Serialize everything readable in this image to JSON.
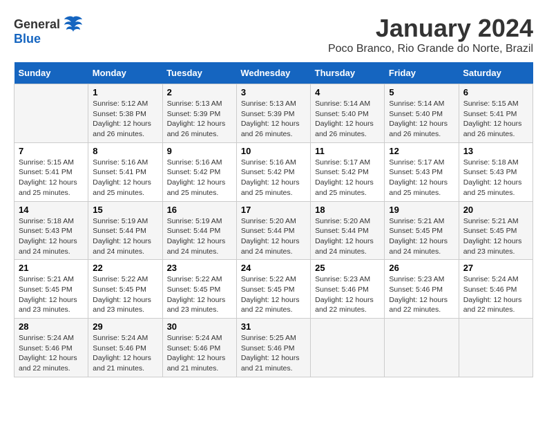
{
  "header": {
    "logo_general": "General",
    "logo_blue": "Blue",
    "month_year": "January 2024",
    "location": "Poco Branco, Rio Grande do Norte, Brazil"
  },
  "calendar": {
    "days_of_week": [
      "Sunday",
      "Monday",
      "Tuesday",
      "Wednesday",
      "Thursday",
      "Friday",
      "Saturday"
    ],
    "weeks": [
      [
        {
          "day": "",
          "info": ""
        },
        {
          "day": "1",
          "info": "Sunrise: 5:12 AM\nSunset: 5:38 PM\nDaylight: 12 hours\nand 26 minutes."
        },
        {
          "day": "2",
          "info": "Sunrise: 5:13 AM\nSunset: 5:39 PM\nDaylight: 12 hours\nand 26 minutes."
        },
        {
          "day": "3",
          "info": "Sunrise: 5:13 AM\nSunset: 5:39 PM\nDaylight: 12 hours\nand 26 minutes."
        },
        {
          "day": "4",
          "info": "Sunrise: 5:14 AM\nSunset: 5:40 PM\nDaylight: 12 hours\nand 26 minutes."
        },
        {
          "day": "5",
          "info": "Sunrise: 5:14 AM\nSunset: 5:40 PM\nDaylight: 12 hours\nand 26 minutes."
        },
        {
          "day": "6",
          "info": "Sunrise: 5:15 AM\nSunset: 5:41 PM\nDaylight: 12 hours\nand 26 minutes."
        }
      ],
      [
        {
          "day": "7",
          "info": "Sunrise: 5:15 AM\nSunset: 5:41 PM\nDaylight: 12 hours\nand 25 minutes."
        },
        {
          "day": "8",
          "info": "Sunrise: 5:16 AM\nSunset: 5:41 PM\nDaylight: 12 hours\nand 25 minutes."
        },
        {
          "day": "9",
          "info": "Sunrise: 5:16 AM\nSunset: 5:42 PM\nDaylight: 12 hours\nand 25 minutes."
        },
        {
          "day": "10",
          "info": "Sunrise: 5:16 AM\nSunset: 5:42 PM\nDaylight: 12 hours\nand 25 minutes."
        },
        {
          "day": "11",
          "info": "Sunrise: 5:17 AM\nSunset: 5:42 PM\nDaylight: 12 hours\nand 25 minutes."
        },
        {
          "day": "12",
          "info": "Sunrise: 5:17 AM\nSunset: 5:43 PM\nDaylight: 12 hours\nand 25 minutes."
        },
        {
          "day": "13",
          "info": "Sunrise: 5:18 AM\nSunset: 5:43 PM\nDaylight: 12 hours\nand 25 minutes."
        }
      ],
      [
        {
          "day": "14",
          "info": "Sunrise: 5:18 AM\nSunset: 5:43 PM\nDaylight: 12 hours\nand 24 minutes."
        },
        {
          "day": "15",
          "info": "Sunrise: 5:19 AM\nSunset: 5:44 PM\nDaylight: 12 hours\nand 24 minutes."
        },
        {
          "day": "16",
          "info": "Sunrise: 5:19 AM\nSunset: 5:44 PM\nDaylight: 12 hours\nand 24 minutes."
        },
        {
          "day": "17",
          "info": "Sunrise: 5:20 AM\nSunset: 5:44 PM\nDaylight: 12 hours\nand 24 minutes."
        },
        {
          "day": "18",
          "info": "Sunrise: 5:20 AM\nSunset: 5:44 PM\nDaylight: 12 hours\nand 24 minutes."
        },
        {
          "day": "19",
          "info": "Sunrise: 5:21 AM\nSunset: 5:45 PM\nDaylight: 12 hours\nand 24 minutes."
        },
        {
          "day": "20",
          "info": "Sunrise: 5:21 AM\nSunset: 5:45 PM\nDaylight: 12 hours\nand 23 minutes."
        }
      ],
      [
        {
          "day": "21",
          "info": "Sunrise: 5:21 AM\nSunset: 5:45 PM\nDaylight: 12 hours\nand 23 minutes."
        },
        {
          "day": "22",
          "info": "Sunrise: 5:22 AM\nSunset: 5:45 PM\nDaylight: 12 hours\nand 23 minutes."
        },
        {
          "day": "23",
          "info": "Sunrise: 5:22 AM\nSunset: 5:45 PM\nDaylight: 12 hours\nand 23 minutes."
        },
        {
          "day": "24",
          "info": "Sunrise: 5:22 AM\nSunset: 5:45 PM\nDaylight: 12 hours\nand 22 minutes."
        },
        {
          "day": "25",
          "info": "Sunrise: 5:23 AM\nSunset: 5:46 PM\nDaylight: 12 hours\nand 22 minutes."
        },
        {
          "day": "26",
          "info": "Sunrise: 5:23 AM\nSunset: 5:46 PM\nDaylight: 12 hours\nand 22 minutes."
        },
        {
          "day": "27",
          "info": "Sunrise: 5:24 AM\nSunset: 5:46 PM\nDaylight: 12 hours\nand 22 minutes."
        }
      ],
      [
        {
          "day": "28",
          "info": "Sunrise: 5:24 AM\nSunset: 5:46 PM\nDaylight: 12 hours\nand 22 minutes."
        },
        {
          "day": "29",
          "info": "Sunrise: 5:24 AM\nSunset: 5:46 PM\nDaylight: 12 hours\nand 21 minutes."
        },
        {
          "day": "30",
          "info": "Sunrise: 5:24 AM\nSunset: 5:46 PM\nDaylight: 12 hours\nand 21 minutes."
        },
        {
          "day": "31",
          "info": "Sunrise: 5:25 AM\nSunset: 5:46 PM\nDaylight: 12 hours\nand 21 minutes."
        },
        {
          "day": "",
          "info": ""
        },
        {
          "day": "",
          "info": ""
        },
        {
          "day": "",
          "info": ""
        }
      ]
    ]
  }
}
